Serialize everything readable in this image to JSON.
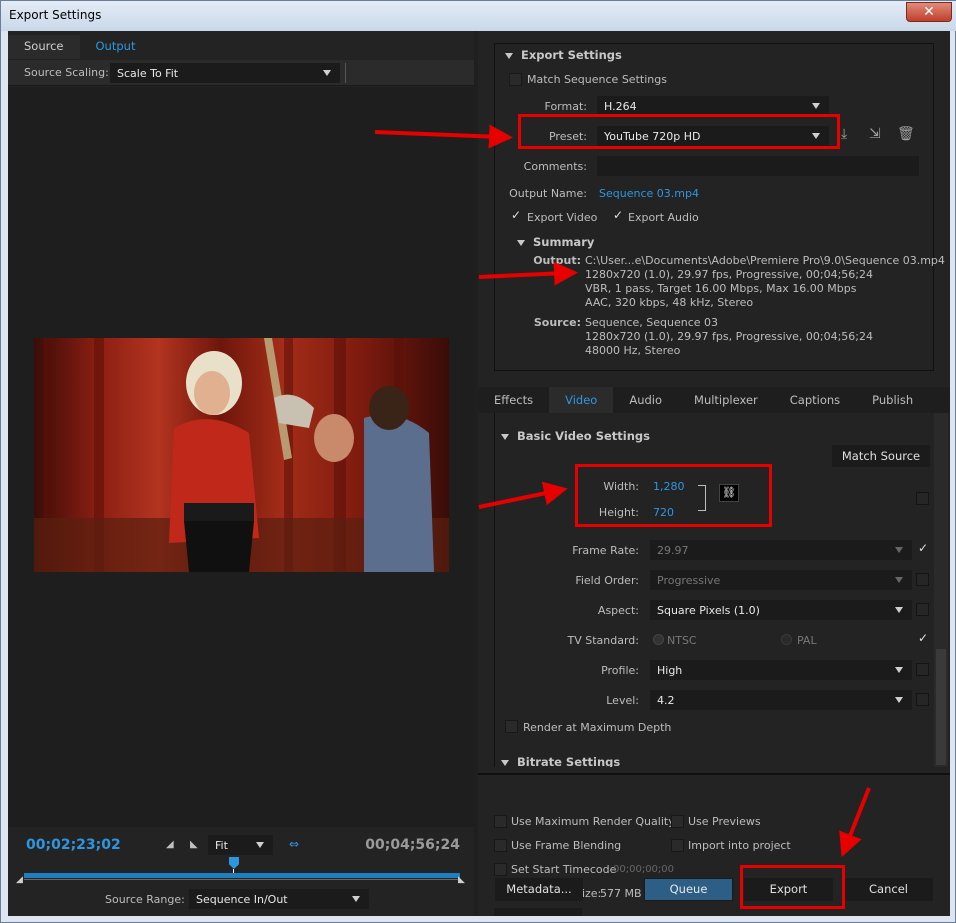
{
  "window": {
    "title": "Export Settings",
    "close_label": "✕"
  },
  "left": {
    "tabs": [
      {
        "label": "Source"
      },
      {
        "label": "Output"
      }
    ],
    "source_scaling_label": "Source Scaling:",
    "source_scaling_value": "Scale To Fit",
    "timecode_current": "00;02;23;02",
    "timecode_total": "00;04;56;24",
    "zoom_value": "Fit",
    "source_range_label": "Source Range:",
    "source_range_value": "Sequence In/Out"
  },
  "export_settings": {
    "header": "Export Settings",
    "match_sequence_label": "Match Sequence Settings",
    "format_label": "Format:",
    "format_value": "H.264",
    "preset_label": "Preset:",
    "preset_value": "YouTube 720p HD",
    "comments_label": "Comments:",
    "comments_value": "",
    "output_name_label": "Output Name:",
    "output_name_value": "Sequence 03.mp4",
    "export_video_label": "Export Video",
    "export_audio_label": "Export Audio",
    "summary_header": "Summary",
    "output_label": "Output:",
    "output_lines": [
      "C:\\User...e\\Documents\\Adobe\\Premiere Pro\\9.0\\Sequence 03.mp4",
      "1280x720 (1.0), 29.97 fps, Progressive, 00;04;56;24",
      "VBR, 1 pass, Target 16.00 Mbps, Max 16.00 Mbps",
      "AAC, 320 kbps, 48 kHz, Stereo"
    ],
    "source_label": "Source:",
    "source_lines": [
      "Sequence, Sequence 03",
      "1280x720 (1.0), 29.97 fps, Progressive, 00;04;56;24",
      "48000 Hz, Stereo"
    ]
  },
  "settings_tabs": [
    {
      "label": "Effects"
    },
    {
      "label": "Video"
    },
    {
      "label": "Audio"
    },
    {
      "label": "Multiplexer"
    },
    {
      "label": "Captions"
    },
    {
      "label": "Publish"
    }
  ],
  "video": {
    "header": "Basic Video Settings",
    "match_source_label": "Match Source",
    "width_label": "Width:",
    "width_value": "1,280",
    "height_label": "Height:",
    "height_value": "720",
    "frame_rate_label": "Frame Rate:",
    "frame_rate_value": "29.97",
    "field_order_label": "Field Order:",
    "field_order_value": "Progressive",
    "aspect_label": "Aspect:",
    "aspect_value": "Square Pixels (1.0)",
    "tv_standard_label": "TV Standard:",
    "ntsc_label": "NTSC",
    "pal_label": "PAL",
    "profile_label": "Profile:",
    "profile_value": "High",
    "level_label": "Level:",
    "level_value": "4.2",
    "render_max_label": "Render at Maximum Depth",
    "bitrate_header": "Bitrate Settings"
  },
  "bottom": {
    "max_render_label": "Use Maximum Render Quality",
    "use_previews_label": "Use Previews",
    "frame_blending_label": "Use Frame Blending",
    "import_label": "Import into project",
    "start_tc_label": "Set Start Timecode",
    "start_tc_value": "00;00;00;00",
    "file_size_label": "Estimated File Size:",
    "file_size_value": "577 MB",
    "metadata_label": "Metadata...",
    "queue_label": "Queue",
    "export_label": "Export",
    "cancel_label": "Cancel"
  },
  "colors": {
    "accent": "#2e96e0",
    "annotation": "#e60000",
    "panel": "#232323"
  }
}
